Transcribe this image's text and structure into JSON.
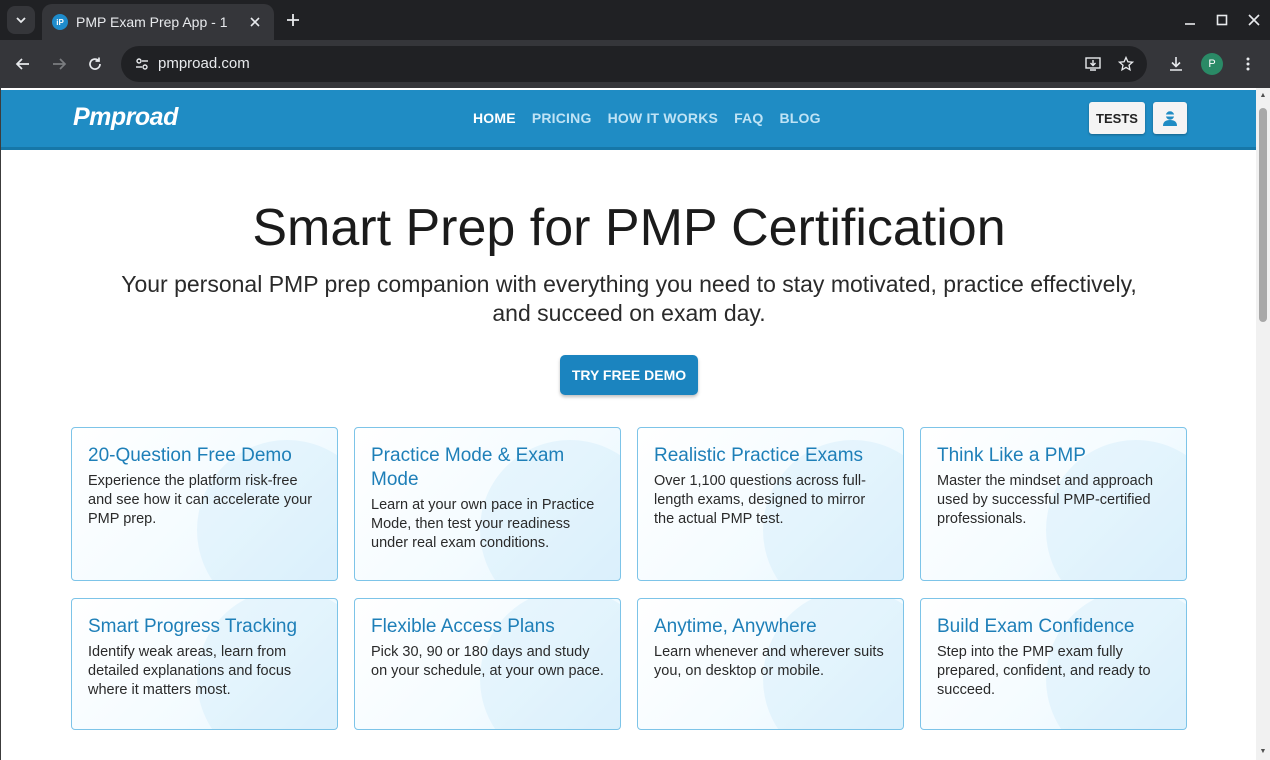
{
  "browser": {
    "tab_title": "PMP Exam Prep App - 1",
    "favicon_text": "iP",
    "url": "pmproad.com",
    "profile_initial": "P"
  },
  "site": {
    "logo": "Pmproad",
    "nav": [
      {
        "label": "HOME",
        "active": true
      },
      {
        "label": "PRICING",
        "active": false
      },
      {
        "label": "HOW IT WORKS",
        "active": false
      },
      {
        "label": "FAQ",
        "active": false
      },
      {
        "label": "BLOG",
        "active": false
      }
    ],
    "tests_label": "TESTS"
  },
  "hero": {
    "title": "Smart Prep for PMP Certification",
    "subtitle": "Your personal PMP prep companion with everything you need to stay motivated, practice effectively, and succeed on exam day.",
    "cta": "TRY FREE DEMO"
  },
  "features": [
    {
      "title": "20-Question Free Demo",
      "text": "Experience the platform risk-free and see how it can accelerate your PMP prep."
    },
    {
      "title": "Practice Mode & Exam Mode",
      "text": "Learn at your own pace in Practice Mode, then test your readiness under real exam conditions."
    },
    {
      "title": "Realistic Practice Exams",
      "text": "Over 1,100 questions across full-length exams, designed to mirror the actual PMP test."
    },
    {
      "title": "Think Like a PMP",
      "text": "Master the mindset and approach used by successful PMP-certified professionals."
    },
    {
      "title": "Smart Progress Tracking",
      "text": "Identify weak areas, learn from detailed explanations and focus where it matters most."
    },
    {
      "title": "Flexible Access Plans",
      "text": "Pick 30, 90 or 180 days and study on your schedule, at your own pace."
    },
    {
      "title": "Anytime, Anywhere",
      "text": "Learn whenever and wherever suits you, on desktop or mobile."
    },
    {
      "title": "Build Exam Confidence",
      "text": "Step into the PMP exam fully prepared, confident, and ready to succeed."
    }
  ],
  "colors": {
    "header": "#1f8cc4",
    "accent": "#1b84bf",
    "card_border": "#7dc4e8"
  }
}
